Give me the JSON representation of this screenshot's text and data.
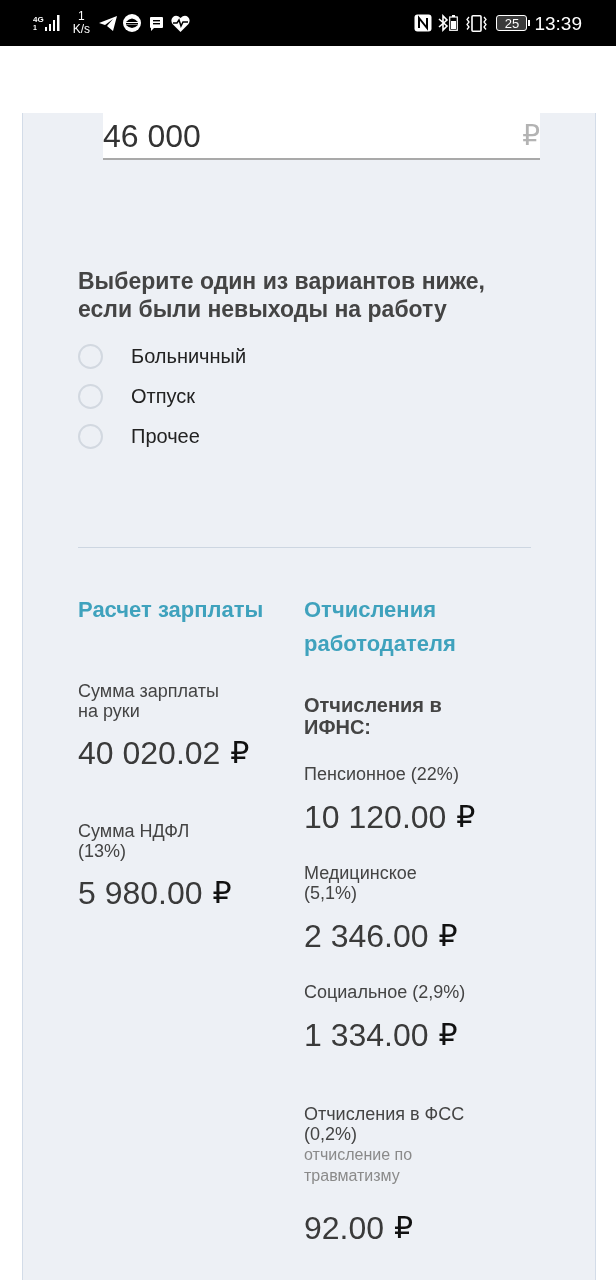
{
  "status_bar": {
    "network": "4G",
    "sim": "1",
    "speed": "1",
    "speed_unit": "K/s",
    "battery": "25",
    "time": "13:39"
  },
  "salary_field": {
    "value": "46 000",
    "currency": "₽"
  },
  "absence": {
    "question": "Выберите один из вариантов ниже, если были невыходы на работу",
    "options": [
      {
        "label": "Больничный",
        "selected": false
      },
      {
        "label": "Отпуск",
        "selected": false
      },
      {
        "label": "Прочее",
        "selected": false
      }
    ]
  },
  "salary_calc": {
    "title": "Расчет зарплаты",
    "items": [
      {
        "label": "Сумма зарплаты на руки",
        "amount": "40 020.02",
        "currency": "₽"
      },
      {
        "label": "Сумма НДФЛ (13%)",
        "amount": "5 980.00",
        "currency": "₽"
      }
    ]
  },
  "employer": {
    "title": "Отчисления работодателя",
    "ifns": {
      "title": "Отчисления в ИФНС:",
      "items": [
        {
          "label": "Пенсионное (22%)",
          "amount": "10 120.00",
          "currency": "₽"
        },
        {
          "label": "Медицинское (5,1%)",
          "amount": "2 346.00",
          "currency": "₽"
        },
        {
          "label": "Социальное (2,9%)",
          "amount": "1 334.00",
          "currency": "₽"
        }
      ]
    },
    "fss": {
      "label": "Отчисления в ФСС (0,2%)",
      "note": "отчисление по травматизму",
      "amount": "92.00",
      "currency": "₽"
    }
  }
}
